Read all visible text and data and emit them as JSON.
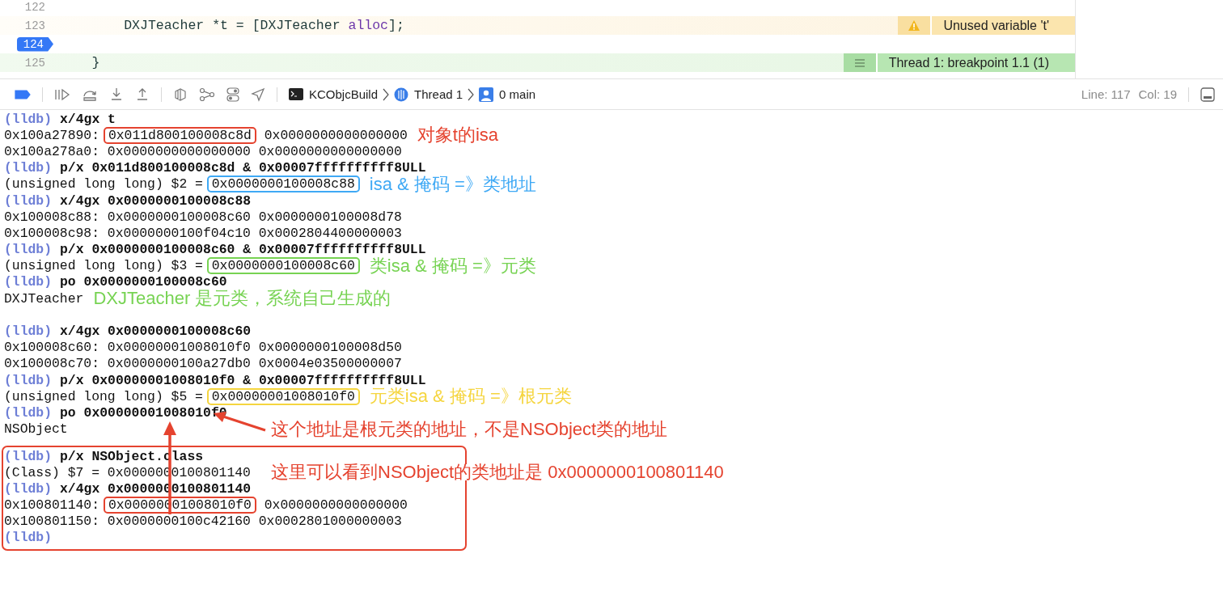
{
  "editor": {
    "lines": [
      {
        "number": "122",
        "breakpoint": false
      },
      {
        "number": "123",
        "breakpoint": false,
        "code": [
          {
            "text": "        DXJTeacher *",
            "kind": "plain"
          },
          {
            "text": "t",
            "kind": "plain"
          },
          {
            "text": " = [DXJTeacher ",
            "kind": "plain"
          },
          {
            "text": "alloc",
            "kind": "method"
          },
          {
            "text": "];",
            "kind": "plain"
          }
        ],
        "annotation": {
          "kind": "warning",
          "text": "Unused variable 't'"
        }
      },
      {
        "number": "124",
        "breakpoint": true
      },
      {
        "number": "125",
        "breakpoint": false,
        "code": [
          {
            "text": "    }",
            "kind": "plain"
          }
        ],
        "annotation": {
          "kind": "thread",
          "text": "Thread 1: breakpoint 1.1 (1)"
        }
      }
    ]
  },
  "toolbar": {
    "breakpoints_active": true,
    "breadcrumbs": [
      {
        "kind": "target",
        "text": "KCObjcBuild"
      },
      {
        "kind": "thread",
        "text": "Thread 1"
      },
      {
        "kind": "frame",
        "text": "0 main"
      }
    ],
    "line": "Line: 117",
    "col": "Col: 19"
  },
  "console": {
    "sections": [
      {
        "boxed": false,
        "lines": [
          {
            "kind": "command",
            "prompt": "(lldb)",
            "command": "x/4gx t"
          },
          {
            "kind": "output",
            "parts": [
              {
                "text": "0x100a27890: "
              },
              {
                "text": "0x011d800100008c8d",
                "boxed": true,
                "color": "#e5432f"
              },
              {
                "text": " 0x0000000000000000"
              }
            ],
            "note": {
              "kind": "label",
              "text": "对象t的isa",
              "color": "#e5432f"
            }
          },
          {
            "kind": "output",
            "parts": [
              {
                "text": "0x100a278a0: 0x0000000000000000 0x0000000000000000"
              }
            ]
          },
          {
            "kind": "command",
            "prompt": "(lldb)",
            "command": "p/x 0x011d800100008c8d & 0x00007ffffffffff8ULL"
          },
          {
            "kind": "output",
            "parts": [
              {
                "text": "(unsigned long long) $2 = "
              },
              {
                "text": "0x0000000100008c88",
                "boxed": true,
                "color": "#3fa9f5"
              }
            ],
            "note": {
              "kind": "label",
              "text": "isa & 掩码 =》类地址",
              "color": "#3fa9f5"
            }
          },
          {
            "kind": "command",
            "prompt": "(lldb)",
            "command": "x/4gx 0x0000000100008c88"
          },
          {
            "kind": "output",
            "parts": [
              {
                "text": "0x100008c88: 0x0000000100008c60 0x0000000100008d78"
              }
            ]
          },
          {
            "kind": "output",
            "parts": [
              {
                "text": "0x100008c98: 0x0000000100f04c10 0x0002804400000003"
              }
            ]
          },
          {
            "kind": "command",
            "prompt": "(lldb)",
            "command": "p/x 0x0000000100008c60 & 0x00007ffffffffff8ULL"
          },
          {
            "kind": "output",
            "parts": [
              {
                "text": "(unsigned long long) $3 = "
              },
              {
                "text": "0x0000000100008c60",
                "boxed": true,
                "color": "#77d353"
              }
            ],
            "note": {
              "kind": "label",
              "text": "类isa & 掩码 =》元类",
              "color": "#77d353"
            }
          },
          {
            "kind": "command",
            "prompt": "(lldb)",
            "command": "po 0x0000000100008c60"
          },
          {
            "kind": "output",
            "parts": [
              {
                "text": "DXJTeacher"
              }
            ],
            "note": {
              "kind": "label",
              "text": "DXJTeacher 是元类，系统自己生成的",
              "color": "#77d353"
            }
          },
          {
            "kind": "blank"
          },
          {
            "kind": "command",
            "prompt": "(lldb)",
            "command": "x/4gx 0x0000000100008c60"
          },
          {
            "kind": "output",
            "parts": [
              {
                "text": "0x100008c60: 0x00000001008010f0 0x0000000100008d50"
              }
            ]
          },
          {
            "kind": "output",
            "parts": [
              {
                "text": "0x100008c70: 0x0000000100a27db0 0x0004e03500000007"
              }
            ]
          },
          {
            "kind": "command",
            "prompt": "(lldb)",
            "command": "p/x 0x00000001008010f0 & 0x00007ffffffffff8ULL"
          },
          {
            "kind": "output",
            "parts": [
              {
                "text": "(unsigned long long) $5 = "
              },
              {
                "text": "0x00000001008010f0",
                "boxed": true,
                "color": "#f5d53f"
              }
            ],
            "note": {
              "kind": "label",
              "text": "元类isa & 掩码 =》根元类",
              "color": "#f5d53f"
            }
          },
          {
            "kind": "command",
            "prompt": "(lldb)",
            "command": "po 0x00000001008010f0"
          },
          {
            "kind": "output",
            "parts": [
              {
                "text": "NSObject"
              }
            ],
            "note": {
              "kind": "callout",
              "text": "这个地址是根元类的地址，不是NSObject类的地址",
              "color": "#e5432f"
            }
          },
          {
            "kind": "blank"
          }
        ]
      },
      {
        "boxed": true,
        "color": "#e5432f",
        "lines": [
          {
            "kind": "command",
            "prompt": "(lldb)",
            "command": "p/x NSObject.class"
          },
          {
            "kind": "output",
            "parts": [
              {
                "text": "(Class) $7 = 0x0000000100801140"
              }
            ],
            "note": {
              "kind": "callout",
              "text": "这里可以看到NSObject的类地址是 0x0000000100801140",
              "color": "#e5432f"
            }
          },
          {
            "kind": "command",
            "prompt": "(lldb)",
            "command": "x/4gx 0x0000000100801140"
          },
          {
            "kind": "output",
            "parts": [
              {
                "text": "0x100801140: "
              },
              {
                "text": "0x00000001008010f0",
                "boxed": true,
                "color": "#e5432f"
              },
              {
                "text": " 0x0000000000000000"
              }
            ]
          },
          {
            "kind": "output",
            "parts": [
              {
                "text": "0x100801150: 0x0000000100c42160 0x0002801000000003"
              }
            ]
          },
          {
            "kind": "command",
            "prompt": "(lldb)"
          }
        ]
      }
    ]
  }
}
